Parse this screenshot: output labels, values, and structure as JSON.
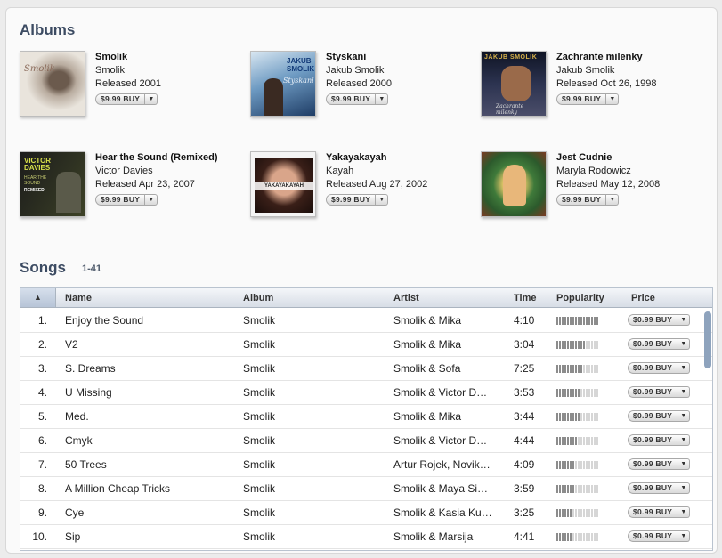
{
  "albums_section": {
    "title": "Albums"
  },
  "albums": [
    {
      "title": "Smolik",
      "artist": "Smolik",
      "released": "Released 2001",
      "price": "$9.99 BUY"
    },
    {
      "title": "Styskani",
      "artist": "Jakub Smolik",
      "released": "Released 2000",
      "price": "$9.99 BUY"
    },
    {
      "title": "Zachrante milenky",
      "artist": "Jakub Smolik",
      "released": "Released Oct 26, 1998",
      "price": "$9.99 BUY"
    },
    {
      "title": "Hear the Sound (Remixed)",
      "artist": "Victor Davies",
      "released": "Released Apr 23, 2007",
      "price": "$9.99 BUY"
    },
    {
      "title": "Yakayakayah",
      "artist": "Kayah",
      "released": "Released Aug 27, 2002",
      "price": "$9.99 BUY"
    },
    {
      "title": "Jest Cudnie",
      "artist": "Maryla Rodowicz",
      "released": "Released May 12, 2008",
      "price": "$9.99 BUY"
    }
  ],
  "covers": {
    "c0": {
      "text": "Smolik"
    },
    "c1": {
      "line1": "JAKUB",
      "line2": "SMOLIK",
      "line3": "Styskani"
    },
    "c2": {
      "top": "JAKUB SMOLIK",
      "bottom": "Zachrante milenky"
    },
    "c3": {
      "line1": "VICTOR",
      "line2": "DAVIES",
      "line3": "HEAR THE SOUND",
      "line4": "REMIXED"
    },
    "c4": {
      "text": "YAKAYAKAYAH"
    }
  },
  "songs_section": {
    "title": "Songs",
    "range": "1-41"
  },
  "table": {
    "columns": {
      "name": "Name",
      "album": "Album",
      "artist": "Artist",
      "time": "Time",
      "popularity": "Popularity",
      "price": "Price"
    },
    "sort_indicator": "▲",
    "rows": [
      {
        "num": "1.",
        "name": "Enjoy the Sound",
        "album": "Smolik",
        "artist": "Smolik & Mika",
        "time": "4:10",
        "popularity": 1.0,
        "price": "$0.99 BUY"
      },
      {
        "num": "2.",
        "name": "V2",
        "album": "Smolik",
        "artist": "Smolik & Mika",
        "time": "3:04",
        "popularity": 0.7,
        "price": "$0.99 BUY"
      },
      {
        "num": "3.",
        "name": "S. Dreams",
        "album": "Smolik",
        "artist": "Smolik & Sofa",
        "time": "7:25",
        "popularity": 0.65,
        "price": "$0.99 BUY"
      },
      {
        "num": "4.",
        "name": "U Missing",
        "album": "Smolik",
        "artist": "Smolik & Victor D…",
        "time": "3:53",
        "popularity": 0.55,
        "price": "$0.99 BUY"
      },
      {
        "num": "5.",
        "name": "Med.",
        "album": "Smolik",
        "artist": "Smolik & Mika",
        "time": "3:44",
        "popularity": 0.55,
        "price": "$0.99 BUY"
      },
      {
        "num": "6.",
        "name": "Cmyk",
        "album": "Smolik",
        "artist": "Smolik & Victor D…",
        "time": "4:44",
        "popularity": 0.5,
        "price": "$0.99 BUY"
      },
      {
        "num": "7.",
        "name": "50 Trees",
        "album": "Smolik",
        "artist": "Artur Rojek, Novik…",
        "time": "4:09",
        "popularity": 0.45,
        "price": "$0.99 BUY"
      },
      {
        "num": "8.",
        "name": "A Million Cheap Tricks",
        "album": "Smolik",
        "artist": "Smolik & Maya Si…",
        "time": "3:59",
        "popularity": 0.45,
        "price": "$0.99 BUY"
      },
      {
        "num": "9.",
        "name": "Cye",
        "album": "Smolik",
        "artist": "Smolik & Kasia Ku…",
        "time": "3:25",
        "popularity": 0.4,
        "price": "$0.99 BUY"
      },
      {
        "num": "10.",
        "name": "Sip",
        "album": "Smolik",
        "artist": "Smolik & Marsija",
        "time": "4:41",
        "popularity": 0.4,
        "price": "$0.99 BUY"
      }
    ]
  },
  "colors": {
    "heading": "#3c4b62",
    "pop_filled": "#8c8c8c",
    "pop_empty": "#d6d6d6"
  },
  "icons": {
    "dropdown": "chevron-down-icon",
    "sort": "sort-up-icon"
  }
}
